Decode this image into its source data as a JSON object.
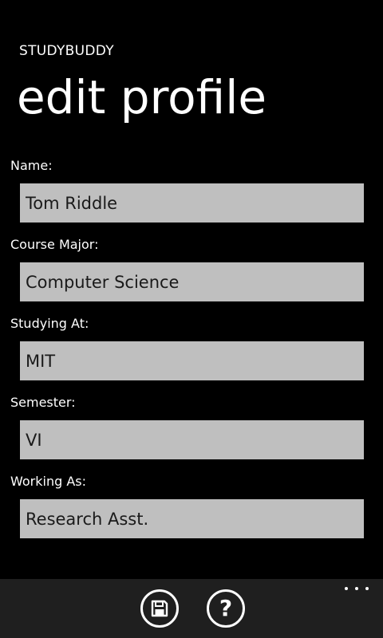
{
  "header": {
    "app_title": "STUDYBUDDY",
    "page_title": "edit profile"
  },
  "form": {
    "fields": [
      {
        "label": "Name:",
        "value": "Tom Riddle"
      },
      {
        "label": "Course Major:",
        "value": "Computer Science"
      },
      {
        "label": "Studying At:",
        "value": "MIT"
      },
      {
        "label": "Semester:",
        "value": "VI"
      },
      {
        "label": "Working As:",
        "value": "Research Asst."
      }
    ]
  },
  "app_bar": {
    "buttons": [
      {
        "icon": "save-icon"
      },
      {
        "icon": "help-icon",
        "glyph": "?"
      }
    ],
    "more_icon": "ellipsis-icon"
  },
  "colors": {
    "background": "#000000",
    "input_background": "#bfbfbf",
    "input_text": "#1a1a1a",
    "app_bar_background": "#1f1f1f",
    "foreground": "#ffffff"
  }
}
